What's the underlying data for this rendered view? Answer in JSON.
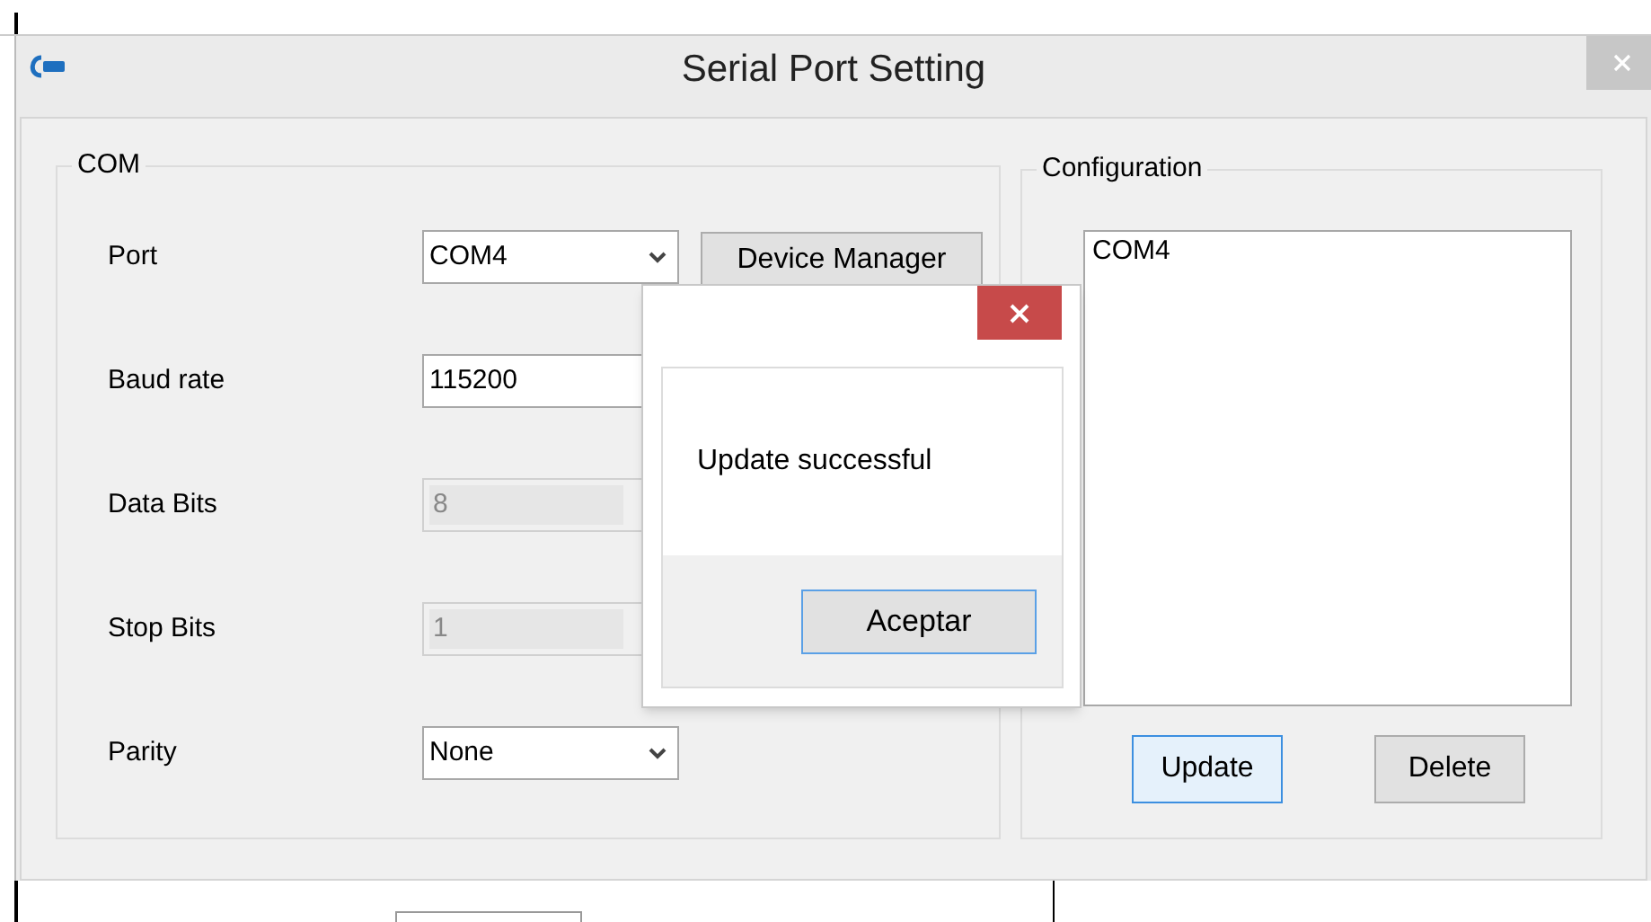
{
  "window": {
    "title": "Serial Port Setting"
  },
  "com_group": {
    "title": "COM",
    "fields": [
      {
        "label": "Port",
        "kind": "dropdown",
        "value": "COM4",
        "disabled": false
      },
      {
        "label": "Baud rate",
        "kind": "text",
        "value": "115200",
        "disabled": false
      },
      {
        "label": "Data Bits",
        "kind": "text",
        "value": "8",
        "disabled": true
      },
      {
        "label": "Stop Bits",
        "kind": "text",
        "value": "1",
        "disabled": true
      },
      {
        "label": "Parity",
        "kind": "dropdown",
        "value": "None",
        "disabled": false
      }
    ],
    "device_manager_button": "Device Manager"
  },
  "configuration_group": {
    "title": "Configuration",
    "items": [
      {
        "label": "COM4",
        "selected": false
      }
    ],
    "buttons": [
      {
        "label": "Update",
        "focused": true
      },
      {
        "label": "Delete",
        "focused": false
      }
    ]
  },
  "message_box": {
    "message": "Update successful",
    "button": {
      "label": "Aceptar",
      "focused": true
    }
  }
}
